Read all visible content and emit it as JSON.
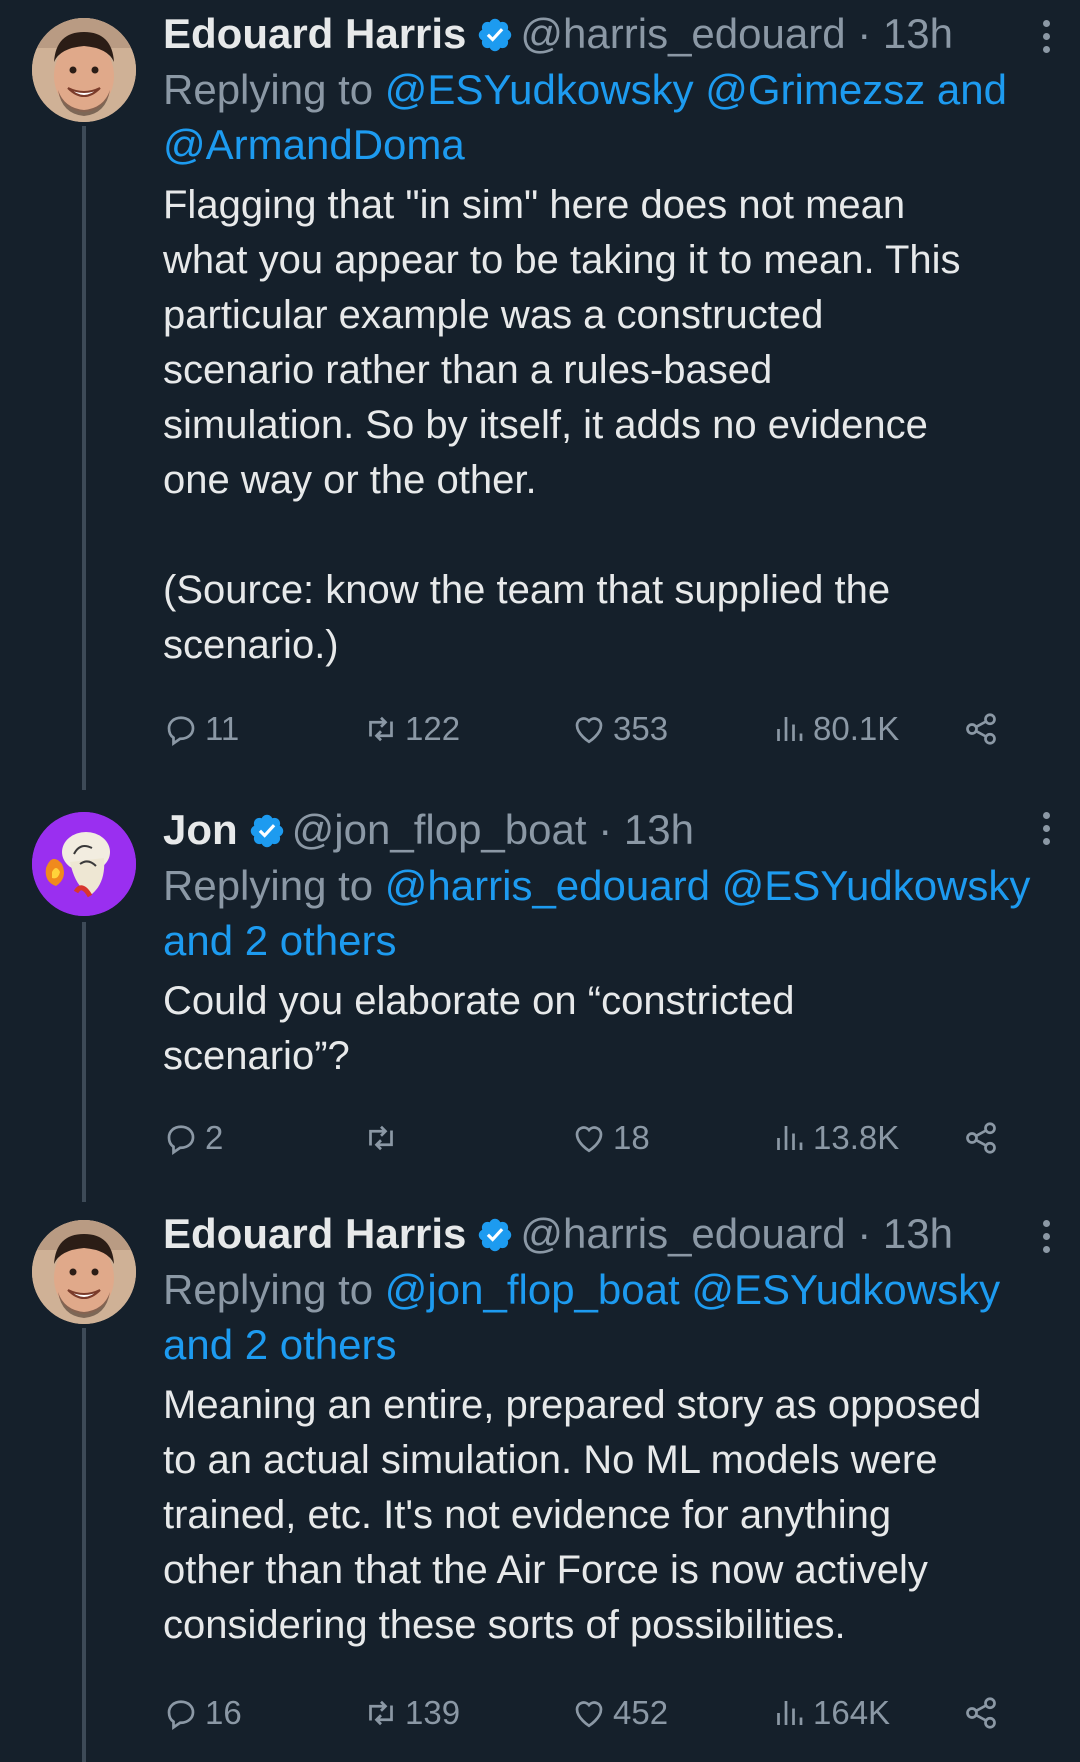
{
  "tweets": [
    {
      "name": "Edouard Harris",
      "handle": "@harris_edouard",
      "time": "· 13h",
      "reply_prefix": "Replying to",
      "mentions_line1": "@ESYudkowsky @Grimezsz and",
      "mentions_line2": "@ArmandDoma",
      "text": "Flagging that \"in sim\" here does not mean\nwhat you appear to be taking it to mean. This\nparticular example was a constructed\nscenario rather than a rules-based\nsimulation. So by itself, it adds no evidence\none way or the other.\n\n(Source: know the team that supplied the\nscenario.)",
      "replies": "11",
      "retweets": "122",
      "likes": "353",
      "views": "80.1K"
    },
    {
      "name": "Jon",
      "handle": "@jon_flop_boat",
      "time": "· 13h",
      "reply_prefix": "Replying to",
      "mentions_line1": "@harris_edouard @ESYudkowsky",
      "mentions_line2": "and 2 others",
      "text": "Could you elaborate on “constricted\nscenario”?",
      "replies": "2",
      "retweets": "",
      "likes": "18",
      "views": "13.8K"
    },
    {
      "name": "Edouard Harris",
      "handle": "@harris_edouard",
      "time": "· 13h",
      "reply_prefix": "Replying to",
      "mentions_line1": "@jon_flop_boat @ESYudkowsky",
      "mentions_line2": "and 2 others",
      "text": "Meaning an entire, prepared story as opposed\nto an actual simulation. No ML models were\ntrained, etc. It's not evidence for anything\nother than that the Air Force is now actively\nconsidering these sorts of possibilities.",
      "replies": "16",
      "retweets": "139",
      "likes": "452",
      "views": "164K"
    }
  ],
  "colors": {
    "background": "#15202b",
    "link": "#1d9bf0",
    "secondary": "#8b98a5",
    "verified": "#1d9bf0",
    "jon_avatar_bg": "#9a2ff0"
  }
}
